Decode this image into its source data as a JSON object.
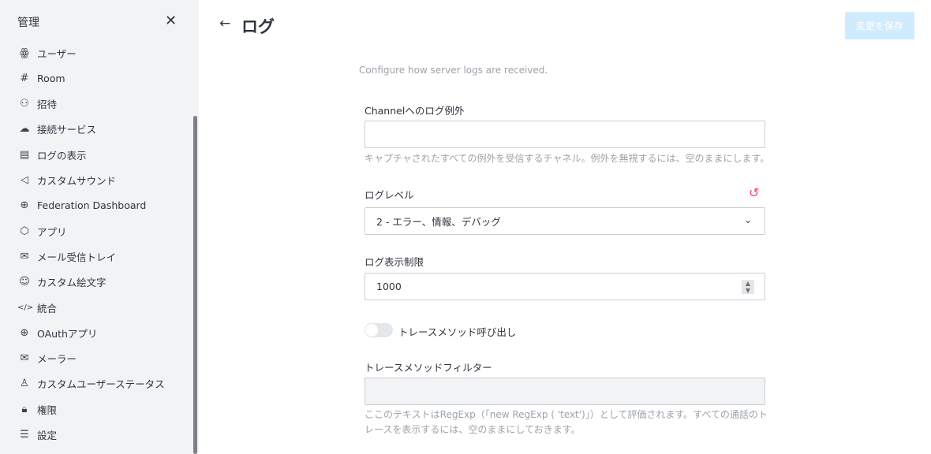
{
  "sidebar": {
    "title": "管理",
    "items": [
      {
        "label": "ユーザー",
        "icon": "team-icon",
        "glyph": "ꙮ"
      },
      {
        "label": "Room",
        "icon": "hashtag-icon",
        "glyph": "#"
      },
      {
        "label": "招待",
        "icon": "user-plus-icon",
        "glyph": "⚇"
      },
      {
        "label": "接続サービス",
        "icon": "cloud-plus-icon",
        "glyph": "☁"
      },
      {
        "label": "ログの表示",
        "icon": "document-icon",
        "glyph": "▤"
      },
      {
        "label": "カスタムサウンド",
        "icon": "volume-icon",
        "glyph": "◁"
      },
      {
        "label": "Federation Dashboard",
        "icon": "globe-icon",
        "glyph": "⊕"
      },
      {
        "label": "アプリ",
        "icon": "cube-icon",
        "glyph": "⬡"
      },
      {
        "label": "メール受信トレイ",
        "icon": "mail-icon",
        "glyph": "✉"
      },
      {
        "label": "カスタム絵文字",
        "icon": "emoji-icon",
        "glyph": "☺"
      },
      {
        "label": "統合",
        "icon": "code-icon",
        "glyph": "</>"
      },
      {
        "label": "OAuthアプリ",
        "icon": "globe-icon",
        "glyph": "⊕"
      },
      {
        "label": "メーラー",
        "icon": "mail-icon",
        "glyph": "✉"
      },
      {
        "label": "カスタムユーザーステータス",
        "icon": "user-icon",
        "glyph": "♙"
      },
      {
        "label": "権限",
        "icon": "lock-icon",
        "glyph": "🔒︎"
      },
      {
        "label": "設定",
        "icon": "customize-icon",
        "glyph": "☰"
      }
    ]
  },
  "header": {
    "title": "ログ",
    "save_label": "変更を保存"
  },
  "description": "Configure how server logs are received.",
  "fields": {
    "channel": {
      "label": "Channelへのログ例外",
      "value": "",
      "help": "キャプチャされたすべての例外を受信するチャネル。例外を無視するには、空のままにします。"
    },
    "level": {
      "label": "ログレベル",
      "value": "2 - エラー、情報、デバッグ"
    },
    "limit": {
      "label": "ログ表示制限",
      "value": "1000"
    },
    "trace": {
      "label": "トレースメソッド呼び出し",
      "enabled": false
    },
    "filter": {
      "label": "トレースメソッドフィルター",
      "value": "",
      "help": "ここのテキストはRegExp（「new RegExp ( 'text')」）として評価されます。すべての通話のトレースを表示するには、空のままにしておきます。"
    }
  },
  "colors": {
    "accent_disabled": "#d1ebfe",
    "reset": "#f5455c"
  }
}
